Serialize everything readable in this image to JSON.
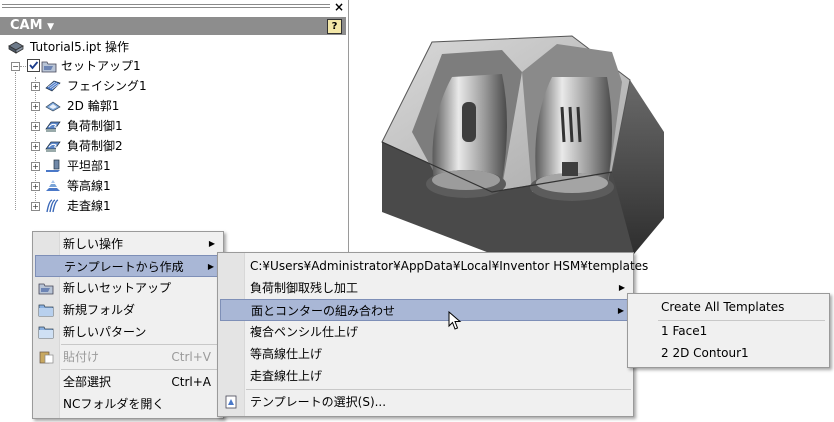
{
  "panel": {
    "title": "CAM",
    "help_label": "?",
    "close_label": "×",
    "tree": {
      "root": "Tutorial5.ipt 操作",
      "setup": "セットアップ1",
      "ops": [
        {
          "label": "フェイシング1",
          "icon": "facing-icon"
        },
        {
          "label": "2D 輪郭1",
          "icon": "contour-2d-icon"
        },
        {
          "label": "負荷制御1",
          "icon": "adaptive-icon"
        },
        {
          "label": "負荷制御2",
          "icon": "adaptive-icon"
        },
        {
          "label": "平坦部1",
          "icon": "horizontal-icon"
        },
        {
          "label": "等高線1",
          "icon": "contour-icon"
        },
        {
          "label": "走査線1",
          "icon": "parallel-icon"
        }
      ]
    }
  },
  "menu1": {
    "items": [
      {
        "label": "新しい操作",
        "submenu": true
      },
      {
        "label": "テンプレートから作成",
        "submenu": true,
        "highlighted": true
      },
      {
        "label": "新しいセットアップ"
      },
      {
        "label": "新規フォルダ"
      },
      {
        "label": "新しいパターン"
      },
      {
        "label": "貼付け",
        "shortcut": "Ctrl+V",
        "disabled": true
      },
      {
        "label": "全部選択",
        "shortcut": "Ctrl+A"
      },
      {
        "label": "NCフォルダを開く"
      }
    ]
  },
  "menu2": {
    "items": [
      {
        "label": "C:¥Users¥Administrator¥AppData¥Local¥Inventor HSM¥templates"
      },
      {
        "label": "負荷制御取残し加工",
        "submenu": true
      },
      {
        "label": "面とコンターの組み合わせ",
        "submenu": true,
        "highlighted": true
      },
      {
        "label": "複合ペンシル仕上げ"
      },
      {
        "label": "等高線仕上げ"
      },
      {
        "label": "走査線仕上げ"
      },
      {
        "label": "テンプレートの選択(S)..."
      }
    ]
  },
  "menu3": {
    "items": [
      {
        "label": "Create All Templates"
      },
      {
        "label": "1 Face1"
      },
      {
        "label": "2 2D Contour1"
      }
    ]
  },
  "colors": {
    "highlight": "#a9b7d6",
    "header": "#8d8d8d",
    "menu_bg": "#f0f0f0"
  }
}
